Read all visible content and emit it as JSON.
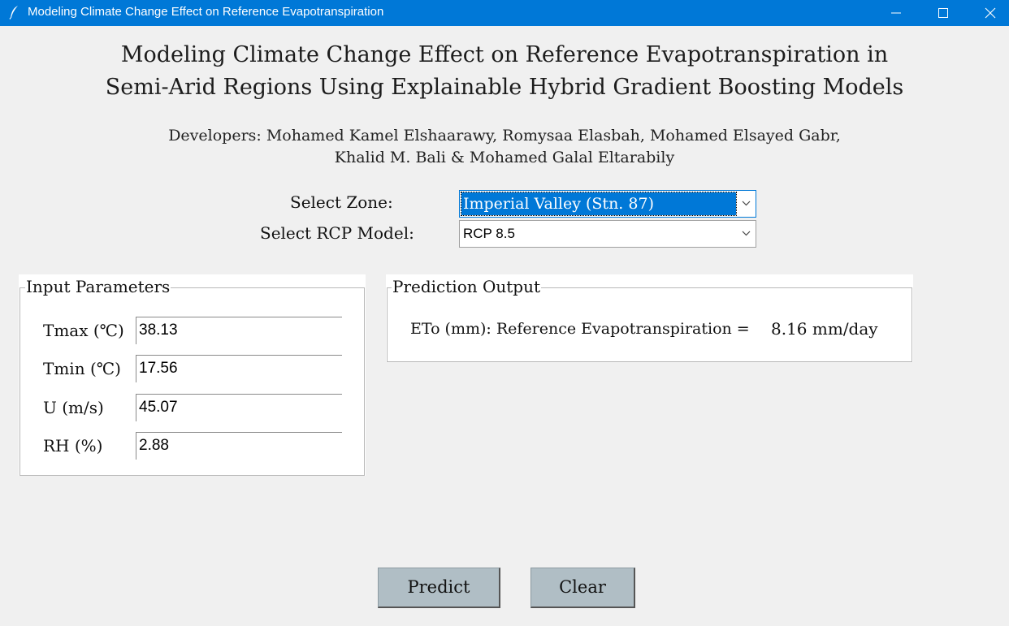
{
  "window": {
    "title": "Modeling Climate Change Effect on Reference Evapotranspiration",
    "icon": "feather-icon"
  },
  "header": {
    "title_line1": "Modeling Climate Change Effect on Reference Evapotranspiration in",
    "title_line2": "Semi-Arid Regions Using Explainable Hybrid Gradient Boosting Models",
    "developers_line1": "Developers: Mohamed Kamel Elshaarawy, Romysaa Elasbah, Mohamed Elsayed Gabr,",
    "developers_line2": "Khalid M. Bali & Mohamed Galal Eltarabily"
  },
  "selectors": {
    "zone_label": "Select Zone:",
    "zone_value": "Imperial Valley (Stn. 87)",
    "rcp_label": "Select RCP Model:",
    "rcp_value": "RCP 8.5"
  },
  "inputs": {
    "legend": "Input Parameters",
    "tmax_label": "Tmax (℃)",
    "tmax_value": "38.13",
    "tmin_label": "Tmin (℃)",
    "tmin_value": "17.56",
    "u_label": "U (m/s)",
    "u_value": "45.07",
    "rh_label": "RH (%)",
    "rh_value": "2.88"
  },
  "output": {
    "legend": "Prediction Output",
    "label": "ETo (mm): Reference Evapotranspiration =",
    "value": "8.16 mm/day"
  },
  "buttons": {
    "predict": "Predict",
    "clear": "Clear"
  },
  "colors": {
    "titlebar": "#0078d7",
    "button_bg": "#b0bec5",
    "selection": "#0078d7"
  }
}
